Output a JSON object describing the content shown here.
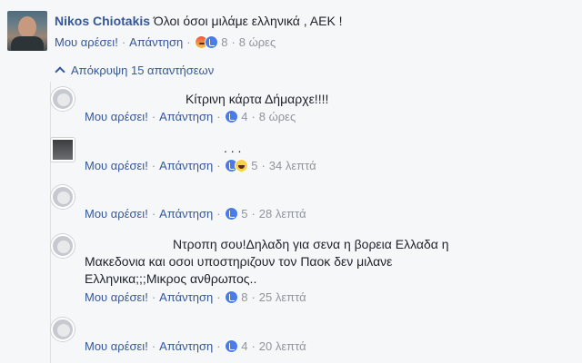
{
  "top_comment": {
    "author": "Nikos Chiotakis",
    "text": "Όλοι όσοι μιλάμε ελληνικά , ΑΕΚ !",
    "like_label": "Μου αρέσει!",
    "reply_label": "Απάντηση",
    "reaction_count": "8",
    "time": "8 ώρες"
  },
  "hide_replies_label": "Απόκρυψη 15 απαντήσεων",
  "replies": [
    {
      "text": "Κίτρινη κάρτα Δήμαρχε!!!!",
      "like_label": "Μου αρέσει!",
      "reply_label": "Απάντηση",
      "reaction_count": "4",
      "time": "8 ώρες"
    },
    {
      "text": ". . .",
      "like_label": "Μου αρέσει!",
      "reply_label": "Απάντηση",
      "reaction_count": "5",
      "time": "34 λεπτά"
    },
    {
      "text": "",
      "like_label": "Μου αρέσει!",
      "reply_label": "Απάντηση",
      "reaction_count": "5",
      "time": "28 λεπτά"
    },
    {
      "text_lines": [
        "Ντροπη σου!Δηλαδη για σενα η βορεια Ελλαδα η",
        "Μακεδονια και οσοι υποστηριζουν τον Παοκ δεν μιλανε",
        "Ελληνικα;;;Μικρος ανθρωπος.."
      ],
      "like_label": "Μου αρέσει!",
      "reply_label": "Απάντηση",
      "reaction_count": "8",
      "time": "25 λεπτά"
    },
    {
      "text": "",
      "like_label": "Μου αρέσει!",
      "reply_label": "Απάντηση",
      "reaction_count": "4",
      "time": "20 λεπτά"
    }
  ],
  "colors": {
    "link": "#365899",
    "muted": "#90949c",
    "background": "#f6f7f9"
  }
}
